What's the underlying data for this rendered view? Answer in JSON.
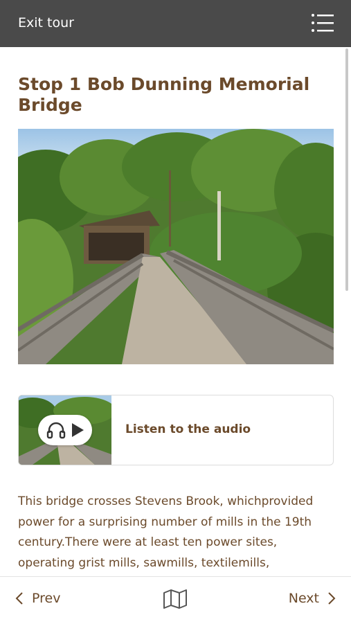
{
  "header": {
    "exit_label": "Exit tour",
    "menu_icon": "list-menu-icon",
    "background": "#4a4a4a"
  },
  "stop": {
    "title": "Stop 1 Bob Dunning Memorial Bridge"
  },
  "audio": {
    "label": "Listen to the audio",
    "icons": [
      "headphones-icon",
      "play-icon"
    ]
  },
  "body": {
    "text": "This bridge crosses Stevens Brook, whichprovided power for a surprising number of mills in the 19th century.There were at least ten power sites, operating grist mills, sawmills, textilemills,"
  },
  "footer": {
    "prev_label": "Prev",
    "next_label": "Next",
    "map_icon": "map-icon"
  },
  "colors": {
    "text_brown": "#6b4a2b",
    "header_gray": "#4a4a4a"
  }
}
